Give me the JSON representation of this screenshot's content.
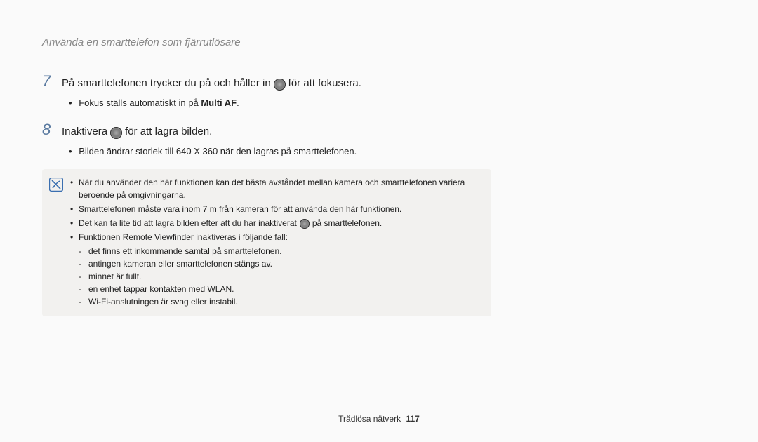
{
  "chapterTitle": "Använda en smarttelefon som fjärrutlösare",
  "steps": [
    {
      "num": "7",
      "pre": "På smarttelefonen trycker du på och håller in",
      "post": "för att fokusera.",
      "sub": {
        "prefix": "Fokus ställs automatiskt in på ",
        "bold": "Multi AF",
        "suffix": "."
      }
    },
    {
      "num": "8",
      "pre": "Inaktivera",
      "post": "för att lagra bilden.",
      "sub": {
        "prefix": "Bilden ändrar storlek till 640 X 360 när den lagras på smarttelefonen.",
        "bold": "",
        "suffix": ""
      }
    }
  ],
  "notes": {
    "b1": "När du använder den här funktionen kan det bästa avståndet mellan kamera och smarttelefonen variera beroende på omgivningarna.",
    "b2": "Smarttelefonen måste vara inom 7 m från kameran för att använda den här funktionen.",
    "b3_pre": "Det kan ta lite tid att lagra bilden efter att du har inaktiverat",
    "b3_post": "på smarttelefonen.",
    "b4": "Funktionen Remote Viewfinder inaktiveras i följande fall:",
    "dashes": [
      "det finns ett inkommande samtal på smarttelefonen.",
      "antingen kameran eller smarttelefonen stängs av.",
      "minnet är fullt.",
      "en enhet tappar kontakten med WLAN.",
      "Wi-Fi-anslutningen är svag eller instabil."
    ]
  },
  "footer": {
    "label": "Trådlösa nätverk",
    "page": "117"
  }
}
